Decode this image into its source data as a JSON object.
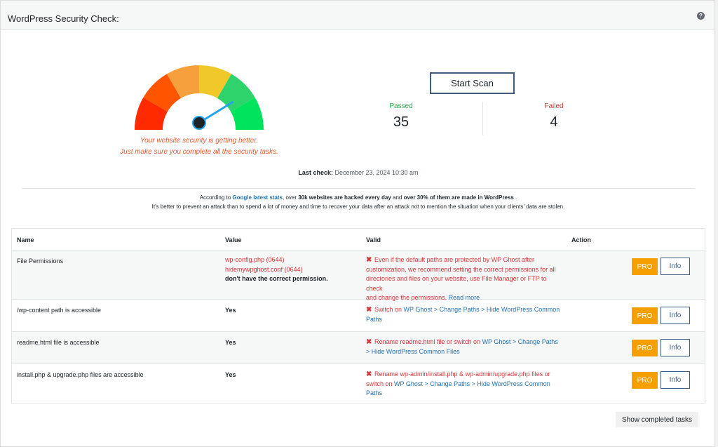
{
  "header": {
    "title": "WordPress Security Check:",
    "help_icon": "question-mark-icon",
    "help_glyph": "?"
  },
  "gauge": {
    "level": 0.78,
    "colors": [
      "#ff2a00",
      "#ff5500",
      "#f5a03c",
      "#f1c82a",
      "#2fd36b",
      "#00e45d"
    ],
    "needle_color": "#23a4e8",
    "message_line1": "Your website security is getting better.",
    "message_line2": "Just make sure you complete all the security tasks."
  },
  "scan": {
    "start_label": "Start Scan"
  },
  "stats": {
    "passed_label": "Passed",
    "passed_value": "35",
    "passed_color": "#27a844",
    "failed_label": "Failed",
    "failed_value": "4",
    "failed_color": "#d63638"
  },
  "last_check": {
    "label": "Last check:",
    "value": "December 23, 2024 10:30 am"
  },
  "notice": {
    "text1": "According to ",
    "link": "Google latest stats",
    "text2": ", over ",
    "bold1": "30k websites are hacked every day",
    "text3": " and ",
    "bold2": "over 30% of them are made in WordPress",
    "text4": " .",
    "line2": "It's better to prevent an attack than to spend a lot of money and time to recover your data after an attack not to mention the situation when your clients' data are stolen."
  },
  "table": {
    "headers": {
      "name": "Name",
      "value": "Value",
      "valid": "Valid",
      "action": "Action"
    },
    "rows": [
      {
        "name": "File Permissions",
        "value_red1": "wp-config.php (0644)",
        "value_red2": "hidemywpghost.conf (0644)",
        "value_bold": "don't have the correct permission.",
        "valid_line1": "Even if the default paths are protected by WP Ghost after",
        "valid_line2": "customization, we recommend setting the correct permissions for all",
        "valid_line3": "directories and files on your website, use File Manager or FTP to check",
        "valid_line4": "and change the permissions.",
        "valid_link": "Read more"
      },
      {
        "name": "/wp-content path is accessible",
        "value_bold": "Yes",
        "valid_text": "Switch on ",
        "valid_link1": "WP Ghost > Change Paths > Hide WordPress Common",
        "valid_link2": "Paths"
      },
      {
        "name": "readme.html file is accessible",
        "value_bold": "Yes",
        "valid_text": "Rename readme.html file or switch on ",
        "valid_link1": "WP Ghost > Change Paths",
        "valid_link2": "> Hide WordPress Common Files"
      },
      {
        "name": "install.php & upgrade.php files are accessible",
        "value_bold": "Yes",
        "valid_text1": "Rename wp-admin/install.php & wp-admin/upgrade.php files or",
        "valid_text2": "switch on ",
        "valid_link1": "WP Ghost > Change Paths > Hide WordPress Common",
        "valid_link2": "Paths"
      }
    ],
    "pro_label": "PRO",
    "info_label": "Info",
    "fail_icon": "red-x-icon",
    "fail_glyph": "✖"
  },
  "footer": {
    "show_completed_label": "Show completed tasks"
  }
}
